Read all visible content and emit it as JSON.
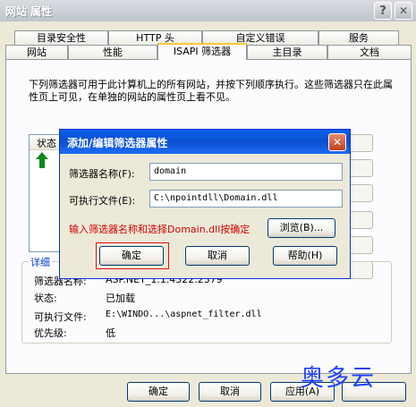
{
  "window": {
    "title": "网站 属性"
  },
  "tabs_row1": [
    "目录安全性",
    "HTTP 头",
    "自定义错误",
    "服务"
  ],
  "tabs_row2": [
    "网站",
    "性能",
    "ISAPI 筛选器",
    "主目录",
    "文档"
  ],
  "description": "下列筛选器可用于此计算机上的所有网站，并按下列顺序执行。这些筛选器只在此属性页上可见，在单独的网站的属性页上看不见。",
  "list": {
    "header": "状态"
  },
  "details": {
    "group_label": "详细",
    "fields": [
      {
        "label": "筛选器名称:",
        "value": "ASP.NET_1.1.4322.2379"
      },
      {
        "label": "状态:",
        "value": "已加载"
      },
      {
        "label": "可执行文件:",
        "value": "E:\\WINDO...\\aspnet_filter.dll"
      },
      {
        "label": "优先级:",
        "value": "低"
      }
    ]
  },
  "footer": {
    "ok": "确定",
    "cancel": "取消",
    "apply": "应用(A)"
  },
  "dialog": {
    "title": "添加/编辑筛选器属性",
    "name_label": "筛选器名称(F):",
    "name_value": "domain",
    "exe_label": "可执行文件(E):",
    "exe_value": "C:\\npointdll\\Domain.dll",
    "hint": "输入筛选器名称和选择Domain.dll按确定",
    "browse": "浏览(B)...",
    "ok": "确定",
    "cancel": "取消",
    "help": "帮助(H)"
  },
  "watermark": "奥多云",
  "colors": {
    "accent": "#0a5fe8",
    "hint_red": "#d50000",
    "check_green": "#0a8a1a"
  }
}
